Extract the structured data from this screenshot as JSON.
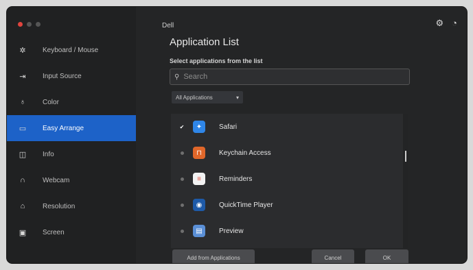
{
  "window": {
    "traffic_colors": [
      "#e0443e",
      "#555555",
      "#555555"
    ],
    "top_label": "Dell",
    "top_icons": [
      "settings-icon",
      "chat-icon"
    ]
  },
  "sidebar": {
    "items": [
      {
        "label": "Keyboard / Mouse",
        "icon": "brightness-icon",
        "glyph": "✲",
        "active": false
      },
      {
        "label": "Input Source",
        "icon": "input-icon",
        "glyph": "⇥",
        "active": false
      },
      {
        "label": "Color",
        "icon": "palette-icon",
        "glyph": "♁",
        "active": false
      },
      {
        "label": "Easy Arrange",
        "icon": "display-icon",
        "glyph": "▭",
        "active": true
      },
      {
        "label": "Info",
        "icon": "columns-icon",
        "glyph": "◫",
        "active": false
      },
      {
        "label": "Webcam",
        "icon": "headset-icon",
        "glyph": "∩",
        "active": false
      },
      {
        "label": "Resolution",
        "icon": "home-icon",
        "glyph": "⌂",
        "active": false
      },
      {
        "label": "Screen",
        "icon": "monitor-icon",
        "glyph": "▣",
        "active": false
      }
    ]
  },
  "main": {
    "title": "Application List",
    "subtitle": "Select applications from the list",
    "search_placeholder": "Search",
    "filter": {
      "label": "All Applications",
      "arrow": "▾"
    },
    "apps": [
      {
        "name": "Safari",
        "checked": true,
        "icon": "safari-icon",
        "glyph": "✦",
        "color": "#2f86e8"
      },
      {
        "name": "Keychain Access",
        "checked": false,
        "icon": "keychain-icon",
        "glyph": "⊓",
        "color": "#e0672a"
      },
      {
        "name": "Reminders",
        "checked": false,
        "icon": "reminders-icon",
        "glyph": "≡",
        "color": "#f2f2f2"
      },
      {
        "name": "QuickTime Player",
        "checked": false,
        "icon": "quicktime-icon",
        "glyph": "◉",
        "color": "#1e5aa8"
      },
      {
        "name": "Preview",
        "checked": false,
        "icon": "preview-icon",
        "glyph": "▤",
        "color": "#5a8fd6"
      }
    ]
  },
  "footer": {
    "browse_label": "Add from Applications",
    "cancel_label": "Cancel",
    "ok_label": "OK"
  }
}
